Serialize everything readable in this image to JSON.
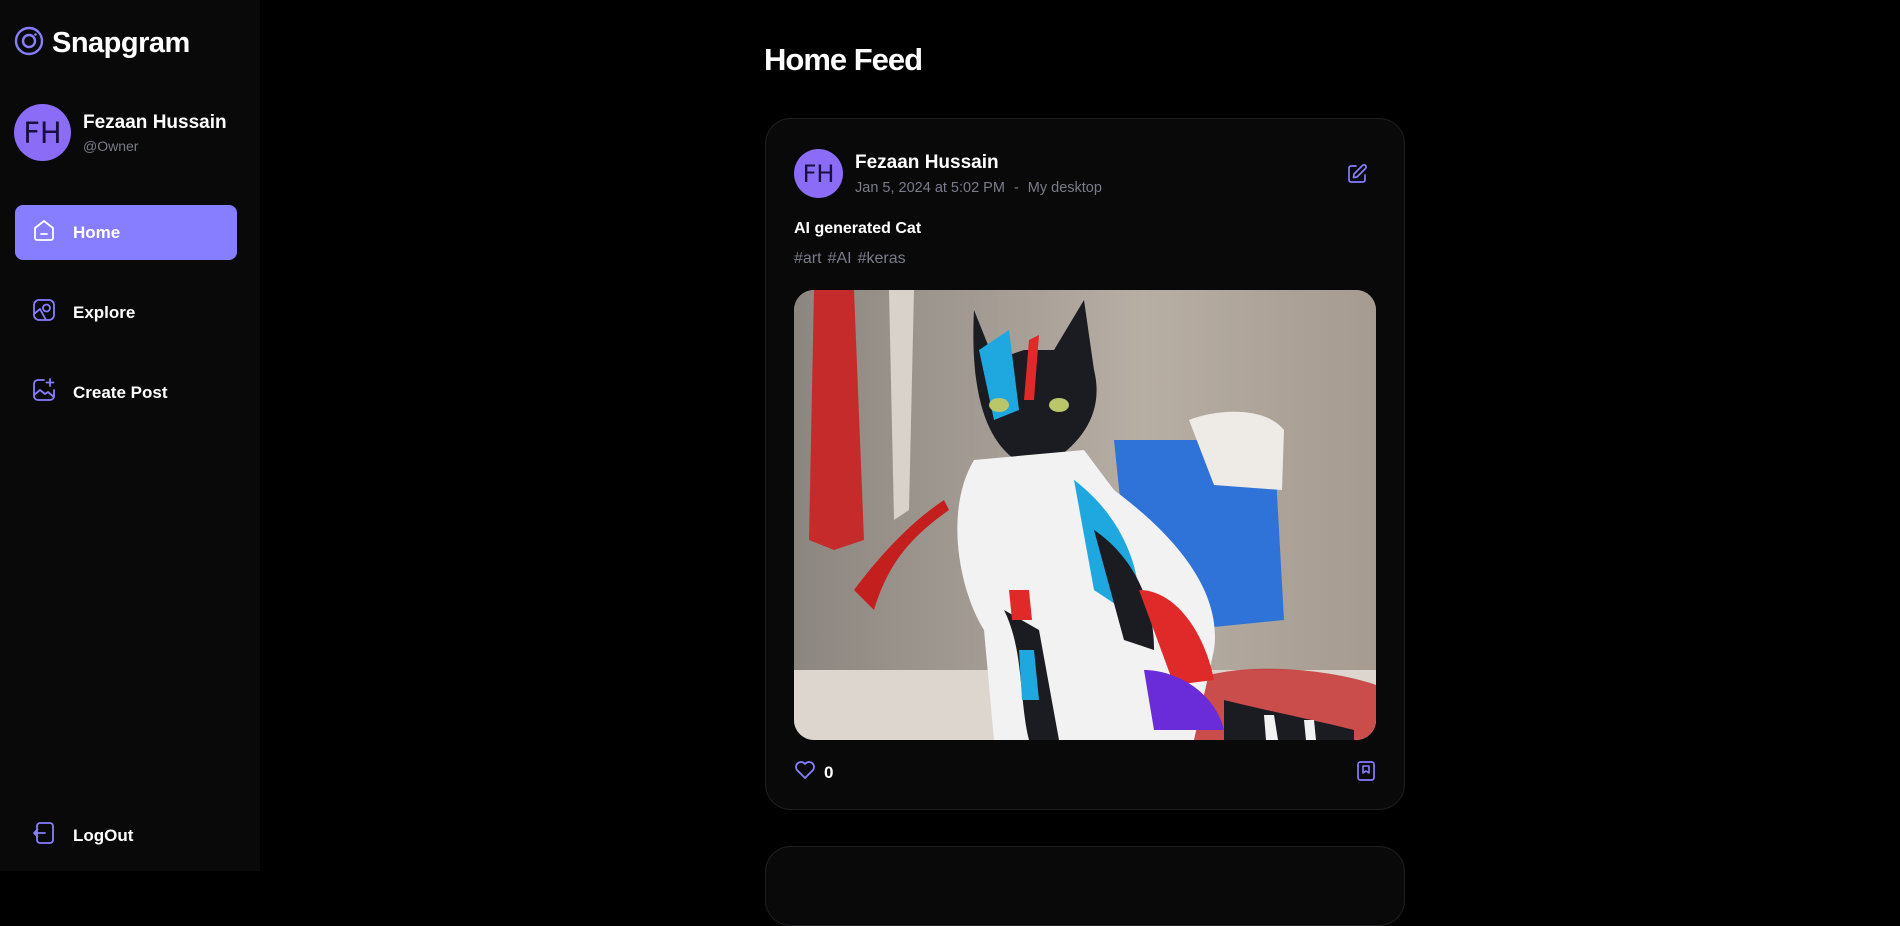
{
  "app": {
    "name": "Snapgram"
  },
  "user": {
    "initials": "FH",
    "name": "Fezaan Hussain",
    "handle": "@Owner"
  },
  "nav": {
    "home": "Home",
    "explore": "Explore",
    "create": "Create Post",
    "logout": "LogOut"
  },
  "page": {
    "title": "Home Feed"
  },
  "post": {
    "author_initials": "FH",
    "author": "Fezaan Hussain",
    "date": "Jan 5, 2024 at 5:02 PM",
    "separator": "-",
    "location": "My desktop",
    "caption": "AI generated Cat",
    "tags": [
      "#art",
      "#AI",
      "#keras"
    ],
    "likes": "0",
    "image_alt": "Colorful painted cat"
  },
  "colors": {
    "accent": "#877eff",
    "background": "#000000",
    "sidebar": "#09090a",
    "muted": "#7b7b8a"
  },
  "icons": [
    "logo-icon",
    "home-icon",
    "explore-icon",
    "create-post-icon",
    "logout-icon",
    "edit-icon",
    "heart-icon",
    "bookmark-icon"
  ]
}
